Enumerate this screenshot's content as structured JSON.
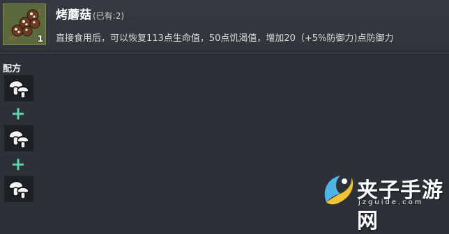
{
  "item": {
    "name": "烤蘑菇",
    "owned": "(已有:2)",
    "count": "1",
    "description": "直接食用后，可以恢复113点生命值，50点饥渴值，增加20（+5%防御力)点防御力",
    "icon": "roasted-mushroom-skewer-icon"
  },
  "recipe": {
    "title": "配方",
    "ingredients": [
      {
        "icon": "mushroom-icon"
      },
      {
        "icon": "mushroom-icon"
      },
      {
        "icon": "mushroom-icon"
      }
    ],
    "plus_symbol": "+"
  },
  "watermark": {
    "text": "夹子手游网",
    "url": "jzguide.com"
  },
  "colors": {
    "background": "#2b3137",
    "slot": "#5b6a3d",
    "plus": "#5fd0a8"
  }
}
